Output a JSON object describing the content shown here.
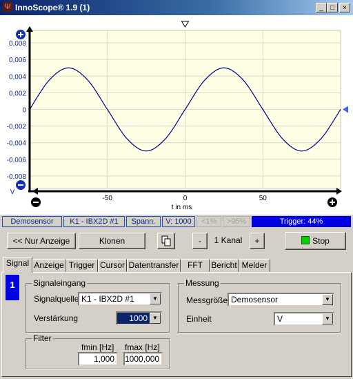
{
  "window": {
    "title": "InnoScope® 1.9 (1)",
    "minimize": "_",
    "maximize": "□",
    "close": "×"
  },
  "chart_data": {
    "type": "line",
    "xlabel": "t in ms",
    "ylabel": "V",
    "xlim": [
      -100,
      100
    ],
    "ylim": [
      -0.0095,
      0.0095
    ],
    "x_ticks": [
      -50,
      0,
      50
    ],
    "y_ticks": [
      0.008,
      0.006,
      0.004,
      0.002,
      0,
      -0.002,
      -0.004,
      -0.006,
      -0.008
    ],
    "x_tick_labels": [
      "-50",
      "0",
      "50"
    ],
    "y_tick_labels": [
      "0,008",
      "0,006",
      "0,004",
      "0,002",
      "0",
      "-0,002",
      "-0,004",
      "-0,006",
      "-0,008"
    ],
    "grid": true,
    "series": [
      {
        "color": "#00008b",
        "x": [
          -100,
          -87.5,
          -75,
          -62.5,
          -50,
          -37.5,
          -25,
          -12.5,
          0,
          12.5,
          25,
          37.5,
          50,
          62.5,
          75,
          87.5,
          100
        ],
        "values": [
          0,
          0.0035,
          0.005,
          0.0035,
          0,
          -0.0035,
          -0.005,
          -0.0035,
          0,
          0.0035,
          0.005,
          0.0035,
          0,
          -0.0035,
          -0.005,
          -0.0035,
          0
        ]
      }
    ]
  },
  "status": {
    "sensor": "Demosensor",
    "channel": "K1 - IBX2D #1",
    "mode": "Spann.",
    "gain": "V: 1000",
    "low": "<1%",
    "high": ">95%",
    "trigger": "Trigger: 44%"
  },
  "toolbar": {
    "display_only": "<< Nur Anzeige",
    "clone": "Klonen",
    "minus": "-",
    "channels": "1 Kanal",
    "plus": "+",
    "stop": "Stop"
  },
  "tabs": [
    "Signal",
    "Anzeige",
    "Trigger",
    "Cursor",
    "Datentransfer",
    "FFT",
    "Bericht",
    "Melder"
  ],
  "channel_badge": "1",
  "signal_input": {
    "title": "Signaleingang",
    "source_label": "Signalquelle",
    "source_value": "K1 - IBX2D #1",
    "gain_label": "Verstärkung",
    "gain_value": "1000"
  },
  "measurement": {
    "title": "Messung",
    "quantity_label": "Messgröße",
    "quantity_value": "Demosensor",
    "unit_label": "Einheit",
    "unit_value": "V"
  },
  "filter": {
    "title": "Filter",
    "fmin_label": "fmin [Hz]",
    "fmax_label": "fmax [Hz]",
    "fmin_value": "1,000",
    "fmax_value": "1000,000"
  }
}
